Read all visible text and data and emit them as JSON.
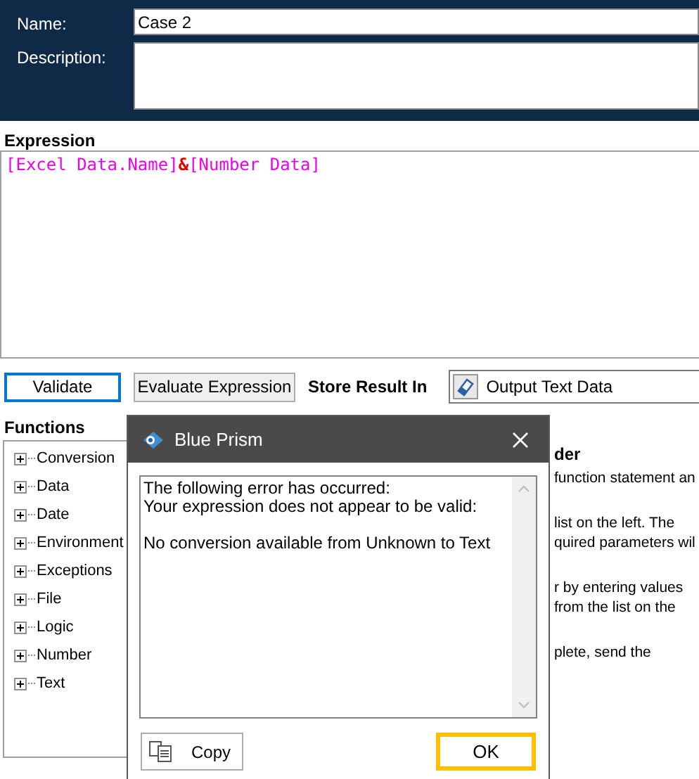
{
  "header": {
    "name_label": "Name:",
    "name_value": "Case 2",
    "description_label": "Description:"
  },
  "expression": {
    "label": "Expression",
    "tokens": [
      {
        "kind": "data",
        "text": "[Excel Data.Name]"
      },
      {
        "kind": "operator",
        "text": "&"
      },
      {
        "kind": "data",
        "text": "[Number Data]"
      }
    ]
  },
  "actions": {
    "validate": "Validate",
    "evaluate": "Evaluate Expression",
    "store_label": "Store Result In",
    "store_value": "Output Text Data"
  },
  "functions": {
    "label": "Functions",
    "items": [
      {
        "label": "Conversion",
        "expanded": false
      },
      {
        "label": "Data",
        "expanded": false
      },
      {
        "label": "Date",
        "expanded": false
      },
      {
        "label": "Environment",
        "expanded": false
      },
      {
        "label": "Exceptions",
        "expanded": false
      },
      {
        "label": "File",
        "expanded": false
      },
      {
        "label": "Logic",
        "expanded": false
      },
      {
        "label": "Number",
        "expanded": false
      },
      {
        "label": "Text",
        "expanded": false
      }
    ]
  },
  "details": {
    "heading": "der",
    "paragraphs": [
      [
        "function statement an"
      ],
      [
        "list on the left. The",
        "quired parameters wil"
      ],
      [
        "r by entering values",
        "from the list on the"
      ],
      [
        "plete, send the"
      ]
    ]
  },
  "dialog": {
    "title": "Blue Prism",
    "paragraphs": [
      [
        "The following error has occurred:",
        "Your expression does not appear to be valid:"
      ],
      [
        "No conversion available from Unknown to Text"
      ]
    ],
    "copy": "Copy",
    "ok": "OK"
  }
}
